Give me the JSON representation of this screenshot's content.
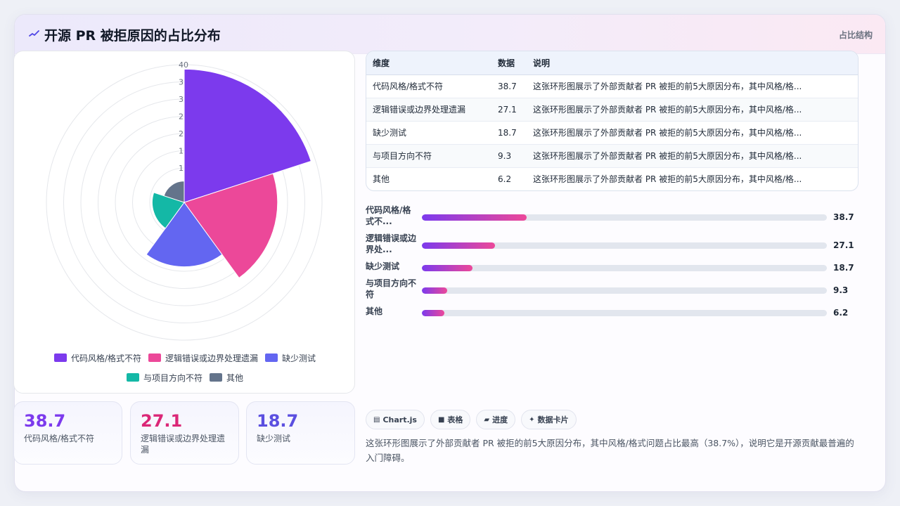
{
  "header": {
    "title": "开源 PR 被拒原因的占比分布",
    "tag": "占比结构",
    "logo_icon": "chart-spark-icon"
  },
  "colors": {
    "purple": "#7c3aed",
    "pink": "#ec4899",
    "indigo": "#6366f1",
    "teal": "#14b8a6",
    "slate": "#64748b"
  },
  "chart_data": {
    "type": "polarArea",
    "categories": [
      "代码风格/格式不符",
      "逻辑错误或边界处理遗漏",
      "缺少测试",
      "与项目方向不符",
      "其他"
    ],
    "values": [
      38.7,
      27.1,
      18.7,
      9.3,
      6.2
    ],
    "colors": [
      "#7c3aed",
      "#ec4899",
      "#6366f1",
      "#14b8a6",
      "#64748b"
    ],
    "rlim": [
      0,
      40
    ],
    "tick_labels": [
      "40",
      "3",
      "3",
      "2",
      "2",
      "1",
      "1",
      "5"
    ],
    "legend_position": "bottom"
  },
  "table": {
    "headers": [
      "维度",
      "数据",
      "说明"
    ],
    "rows": [
      [
        "代码风格/格式不符",
        "38.7",
        "这张环形图展示了外部贡献者 PR 被拒的前5大原因分布，其中风格/格..."
      ],
      [
        "逻辑错误或边界处理遗漏",
        "27.1",
        "这张环形图展示了外部贡献者 PR 被拒的前5大原因分布，其中风格/格..."
      ],
      [
        "缺少测试",
        "18.7",
        "这张环形图展示了外部贡献者 PR 被拒的前5大原因分布，其中风格/格..."
      ],
      [
        "与项目方向不符",
        "9.3",
        "这张环形图展示了外部贡献者 PR 被拒的前5大原因分布，其中风格/格..."
      ],
      [
        "其他",
        "6.2",
        "这张环形图展示了外部贡献者 PR 被拒的前5大原因分布，其中风格/格..."
      ]
    ]
  },
  "progress": {
    "max": 150,
    "items": [
      {
        "label": "代码风格/格式不...",
        "value": "38.7",
        "fraction": 0.258
      },
      {
        "label": "逻辑错误或边界处...",
        "value": "27.1",
        "fraction": 0.181
      },
      {
        "label": "缺少测试",
        "value": "18.7",
        "fraction": 0.125
      },
      {
        "label": "与项目方向不符",
        "value": "9.3",
        "fraction": 0.062
      },
      {
        "label": "其他",
        "value": "6.2",
        "fraction": 0.055
      }
    ]
  },
  "stats": [
    {
      "value": "38.7",
      "label": "代码风格/格式不符",
      "color": "#7c3aed"
    },
    {
      "value": "27.1",
      "label": "逻辑错误或边界处理遗漏",
      "color": "#db2777"
    },
    {
      "value": "18.7",
      "label": "缺少测试",
      "color": "#5b4fe0"
    }
  ],
  "chips": [
    {
      "icon": "chart-icon",
      "glyph": "▤",
      "label": "Chart.js"
    },
    {
      "icon": "table-icon",
      "glyph": "■",
      "label": "表格"
    },
    {
      "icon": "progress-icon",
      "glyph": "▰",
      "label": "进度"
    },
    {
      "icon": "sparkle-icon",
      "glyph": "✦",
      "label": "数据卡片"
    }
  ],
  "summary": "这张环形图展示了外部贡献者 PR 被拒的前5大原因分布，其中风格/格式问题占比最高（38.7%），说明它是开源贡献最普遍的入门障碍。"
}
